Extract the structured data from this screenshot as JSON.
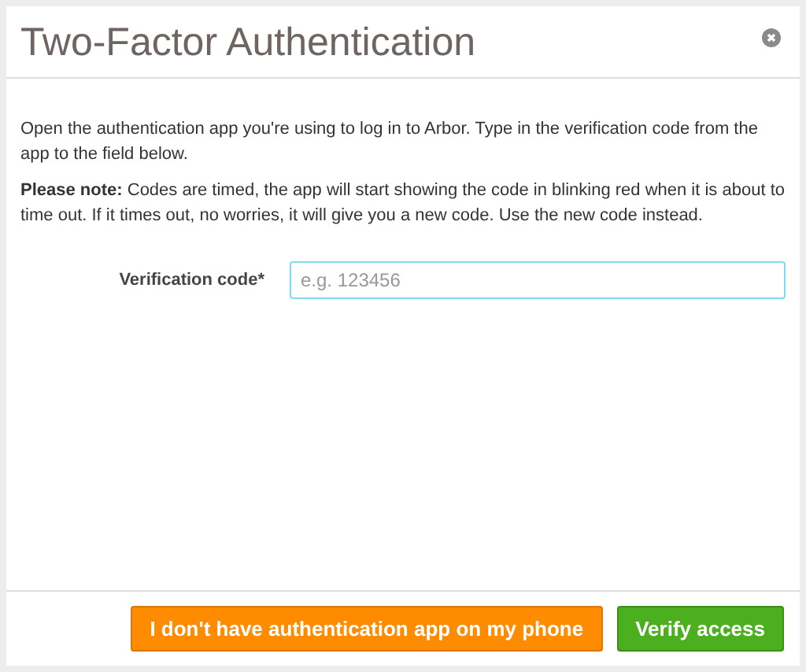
{
  "dialog": {
    "title": "Two-Factor Authentication",
    "paragraphs": [
      "Open the authentication app you're using to log in to Arbor. Type in the verification code from the app to the field below.",
      "**Please note:** Codes are timed, the app will start showing the code in blinking red when it is about to time out. If it times out, no worries, it will give you a new code. Use the new code instead."
    ],
    "field": {
      "label": "Verification code*",
      "placeholder": "e.g. 123456"
    },
    "buttons": [
      {
        "label": "I don't have authentication app on my phone",
        "kind": "warning"
      },
      {
        "label": "Verify access",
        "kind": "primary"
      }
    ]
  }
}
